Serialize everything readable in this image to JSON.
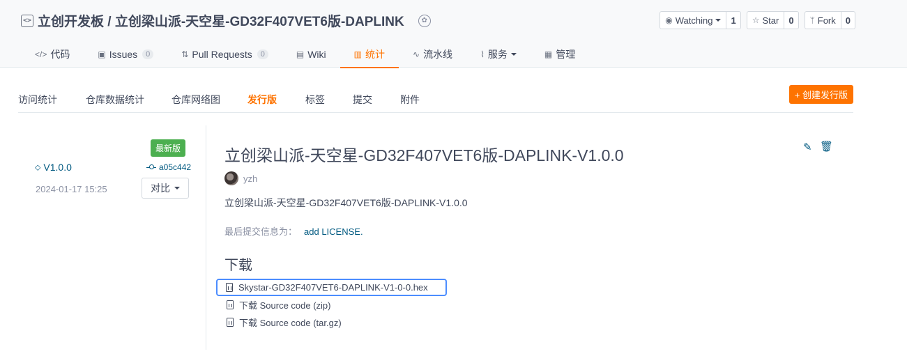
{
  "repo": {
    "title": "立创开发板 / 立创梁山派-天空星-GD32F407VET6版-DAPLINK",
    "watching_label": "Watching",
    "watching_count": "1",
    "star_label": "Star",
    "star_count": "0",
    "fork_label": "Fork",
    "fork_count": "0"
  },
  "tabs": [
    {
      "label": "代码",
      "icon": "code-icon"
    },
    {
      "label": "Issues",
      "count": "0",
      "icon": "issues-icon"
    },
    {
      "label": "Pull Requests",
      "count": "0",
      "icon": "pull-request-icon"
    },
    {
      "label": "Wiki",
      "icon": "wiki-icon"
    },
    {
      "label": "统计",
      "icon": "chart-icon",
      "active": true
    },
    {
      "label": "流水线",
      "icon": "pipeline-icon"
    },
    {
      "label": "服务",
      "icon": "pulse-icon"
    },
    {
      "label": "管理",
      "icon": "settings-icon"
    }
  ],
  "subnav": {
    "items": [
      "访问统计",
      "仓库数据统计",
      "仓库网络图",
      "发行版",
      "标签",
      "提交",
      "附件"
    ],
    "active": "发行版",
    "create_label": "+ 创建发行版"
  },
  "release": {
    "latest_badge": "最新版",
    "tag": "V1.0.0",
    "commit": "a05c442",
    "date": "2024-01-17 15:25",
    "compare_label": "对比",
    "title": "立创梁山派-天空星-GD32F407VET6版-DAPLINK-V1.0.0",
    "author": "yzh",
    "description": "立创梁山派-天空星-GD32F407VET6版-DAPLINK-V1.0.0",
    "last_commit_label": "最后提交信息为：",
    "last_commit_message": "add LICENSE.",
    "download_title": "下载",
    "downloads": [
      "Skystar-GD32F407VET6-DAPLINK-V1-0-0.hex",
      "下载 Source code (zip)",
      "下载 Source code (tar.gz)"
    ]
  },
  "colors": {
    "accent": "#fe7300",
    "link": "#005980",
    "latest": "#4caf50",
    "selection": "#4c8dff"
  }
}
